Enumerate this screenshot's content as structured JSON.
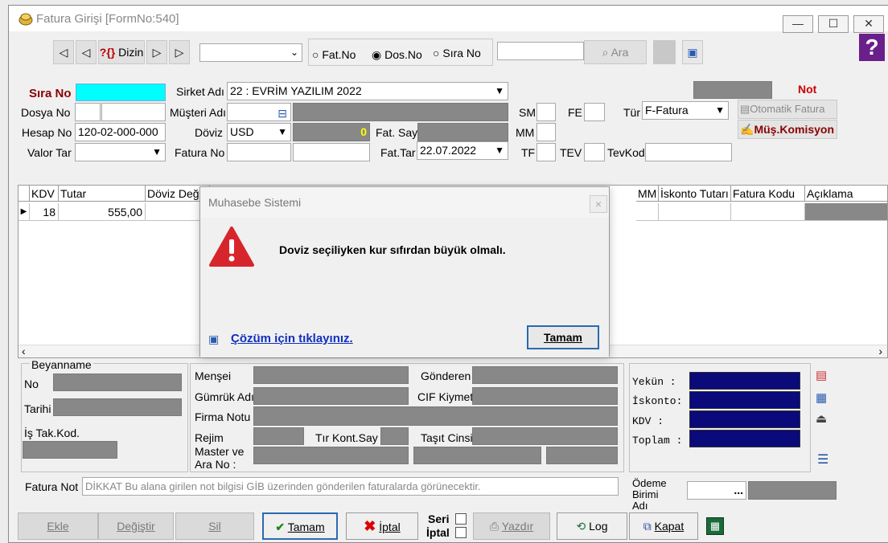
{
  "window": {
    "title": "Fatura Girişi [FormNo:540]",
    "min": "—",
    "max": "☐",
    "close": "✕"
  },
  "toolbar": {
    "dizin": "Dizin",
    "dizin_prefix": "?{}",
    "radio_fatno": "Fat.No",
    "radio_dosno": "Dos.No",
    "radio_sirano": "Sıra No",
    "search_button": "Ara"
  },
  "form": {
    "sira_no_label": "Sıra No",
    "sirket_label": "Sirket Adı",
    "sirket_value": "22 : EVRİM YAZILIM  2022",
    "not_label": "Not",
    "dosya_no_label": "Dosya No",
    "musteri_label": "Müşteri Adı",
    "sm_label": "SM",
    "fe_label": "FE",
    "tur_label": "Tür",
    "tur_value": "F-Fatura",
    "otomatik_button": "Otomatik Fatura",
    "hesap_no_label": "Hesap No",
    "hesap_no_value": "120-02-000-000",
    "doviz_label": "Döviz",
    "doviz_value": "USD",
    "kur_value": "0",
    "fat_say_label": "Fat. Say",
    "mm_label": "MM",
    "komisyon_button": "Müş.Komisyon",
    "valor_label": "Valor Tar",
    "fatura_no_label": "Fatura No",
    "fat_tar_label": "Fat.Tar",
    "fat_tar_value": "22.07.2022",
    "tf_label": "TF",
    "tev_label": "TEV",
    "tevkod_label": "TevKod"
  },
  "grid": {
    "columns": [
      "KDV",
      "Tutar",
      "Döviz Değ",
      "MM",
      "İskonto Tutarı",
      "Fatura Kodu",
      "Açıklama"
    ],
    "row": {
      "kdv": "18",
      "tutar": "555,00"
    }
  },
  "bottom": {
    "beyanname_title": "Beyanname",
    "no_label": "No",
    "tarihi_label": "Tarihi",
    "is_takip_label": "İş Tak.Kod.",
    "mensei_label": "Menşei",
    "gonderen_label": "Gönderen",
    "gumruk_label": "Gümrük Adı",
    "cif_label": "CIF Kiymet",
    "firma_notu_label": "Firma Notu",
    "rejim_label": "Rejim",
    "tir_label": "Tır Kont.Say",
    "tasit_label": "Taşıt Cinsi",
    "master_label": "Master ve",
    "ara_no_label": "Ara No :",
    "yekun_label": "Yekün  :",
    "iskonto_label": "İskonto:",
    "kdv_label": "KDV    :",
    "toplam_label": "Toplam :",
    "fatura_not_label": "Fatura Not",
    "fatura_not_placeholder": "DİKKAT Bu alana girilen not bilgisi GİB üzerinden gönderilen faturalarda görünecektir.",
    "odeme_label_1": "Ödeme",
    "odeme_label_2": "Birimi",
    "odeme_label_3": "Adı",
    "odeme_button": "..."
  },
  "buttons": {
    "ekle": "Ekle",
    "degistir": "Değiştir",
    "sil": "Sil",
    "tamam": "Tamam",
    "iptal": "İptal",
    "seri": "Seri",
    "iptal2": "İptal",
    "yazdir": "Yazdır",
    "log": "Log",
    "kapat": "Kapat"
  },
  "dialog": {
    "title": "Muhasebe Sistemi",
    "close": "×",
    "message": "Doviz seçiliyken kur sıfırdan büyük olmalı.",
    "help_link": "Çözüm için tıklayınız.",
    "ok": "Tamam"
  },
  "colors": {
    "accent": "#0a0a7a",
    "cyan": "#00ffff",
    "dark_red": "#8b0000",
    "error_red": "#d7262b"
  }
}
